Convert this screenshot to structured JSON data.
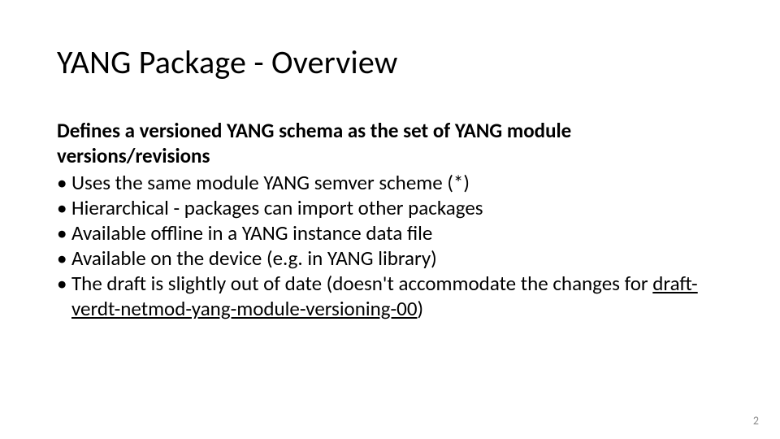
{
  "slide": {
    "title": "YANG Package - Overview",
    "lead": "Defines a versioned YANG schema as the set of YANG module versions/revisions",
    "bullets": [
      "Uses the same module YANG semver scheme (*)",
      "Hierarchical - packages can import other packages",
      "Available offline in a YANG instance data file",
      "Available on the device (e.g. in YANG library)"
    ],
    "lastBullet": {
      "before": "The draft is slightly out of date (doesn't accommodate the changes for ",
      "link": "draft-verdt-netmod-yang-module-versioning-00",
      "after": ")"
    },
    "pageNumber": "2"
  }
}
